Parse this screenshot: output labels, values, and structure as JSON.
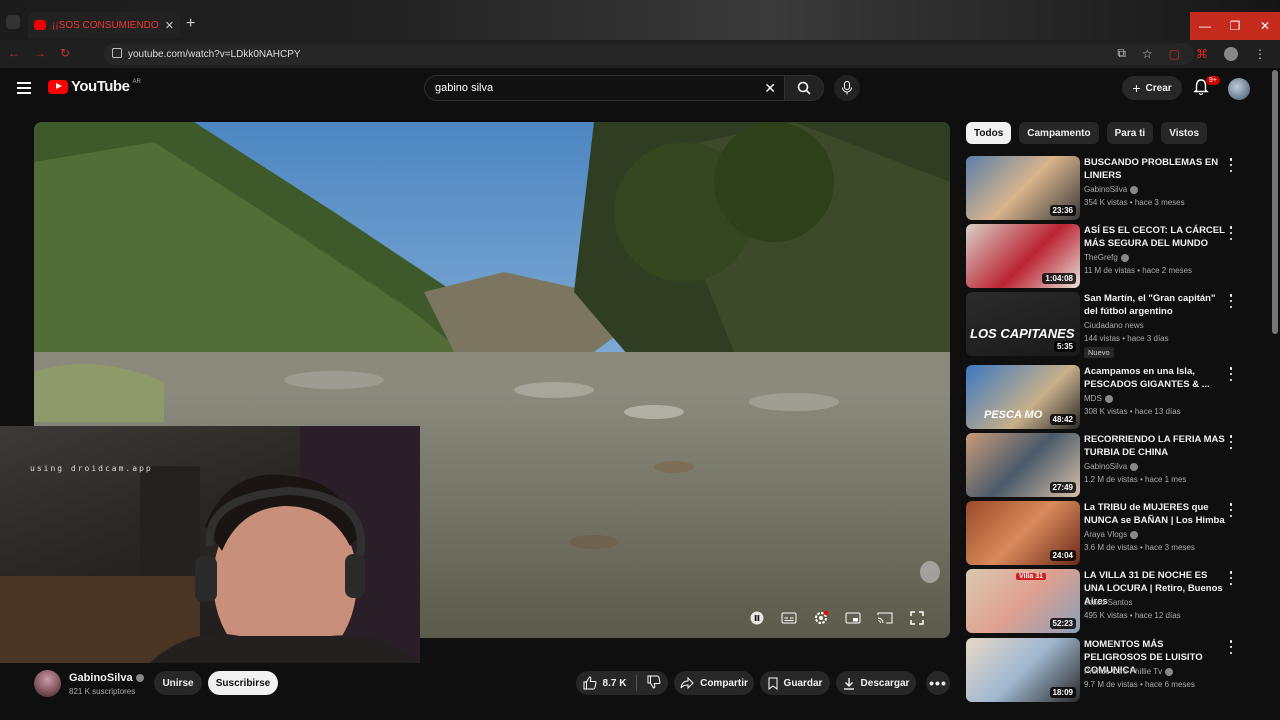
{
  "browser": {
    "tab_title": "¡¡SOS CONSUMIENDO NO?",
    "url": "youtube.com/watch?v=LDkk0NAHCPY"
  },
  "header": {
    "logo_text": "YouTube",
    "country_code": "AR",
    "search_value": "gabino silva",
    "create_label": "Crear",
    "notif_badge": "9+"
  },
  "video": {
    "overlay_text": "using droidcam.app"
  },
  "channel": {
    "name": "GabinoSilva",
    "subscribers": "821 K suscriptores",
    "join_label": "Unirse",
    "subscribe_label": "Suscribirse"
  },
  "actions": {
    "likes": "8.7 K",
    "share": "Compartir",
    "save": "Guardar",
    "download": "Descargar"
  },
  "sidebar": {
    "chips": [
      "Todos",
      "Campamento",
      "Para ti",
      "Vistos"
    ],
    "items": [
      {
        "title": "BUSCANDO PROBLEMAS EN LINIERS",
        "channel": "GabinoSilva",
        "meta": "354 K vistas • hace 3 meses",
        "duration": "23:36",
        "verified": true
      },
      {
        "title": "ASÍ ES EL CECOT: LA CÁRCEL MÁS SEGURA DEL MUNDO",
        "channel": "TheGrefg",
        "meta": "11 M de vistas • hace 2 meses",
        "duration": "1:04:08",
        "verified": true
      },
      {
        "title": "San Martín, el \"Gran capitán\" del fútbol argentino",
        "channel": "Ciudadano news",
        "meta": "144 vistas • hace 3 días",
        "duration": "5:35",
        "badge": "Nuevo",
        "thumb_text": "LOS CAPITANES",
        "verified": false
      },
      {
        "title": "Acampamos en una Isla, PESCADOS GIGANTES & ...",
        "channel": "MDS",
        "meta": "308 K vistas • hace 13 días",
        "duration": "48:42",
        "thumb_text": "PESCA MO",
        "verified": true
      },
      {
        "title": "RECORRIENDO LA FERIA MAS TURBIA DE CHINA",
        "channel": "GabinoSilva",
        "meta": "1.2 M de vistas • hace 1 mes",
        "duration": "27:49",
        "verified": true
      },
      {
        "title": "La TRIBU de MUJERES que NUNCA se BAÑAN | Los Himba",
        "channel": "Araya Vlogs",
        "meta": "3.6 M de vistas • hace 3 meses",
        "duration": "24:04",
        "verified": true
      },
      {
        "title": "LA VILLA 31 DE NOCHE ES UNA LOCURA | Retiro, Buenos Aires",
        "channel": "Joaco Santos",
        "meta": "495 K vistas • hace 12 días",
        "duration": "52:23",
        "thumb_text": "Villa 31",
        "verified": false
      },
      {
        "title": "MOMENTOS MÁS PELIGROSOS DE LUISITO COMUNICA",
        "channel": "Prende Otro Phillie Tv",
        "meta": "9.7 M de vistas • hace 6 meses",
        "duration": "18:09",
        "verified": true
      }
    ]
  }
}
